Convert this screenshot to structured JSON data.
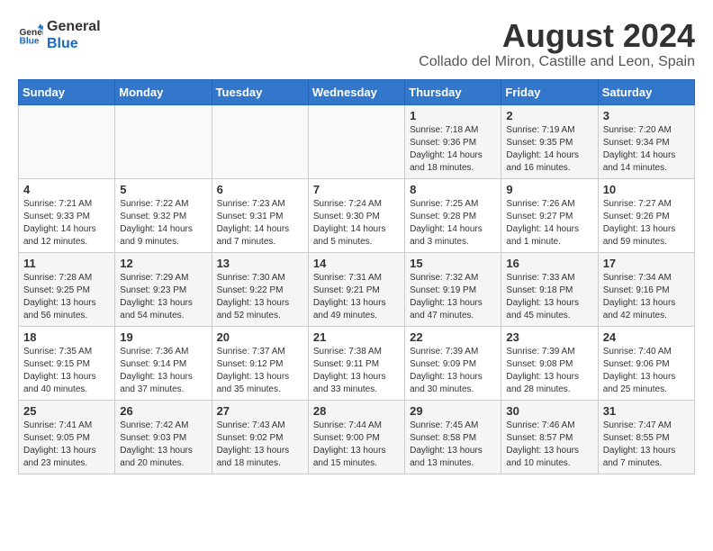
{
  "header": {
    "logo_line1": "General",
    "logo_line2": "Blue",
    "title": "August 2024",
    "subtitle": "Collado del Miron, Castille and Leon, Spain"
  },
  "columns": [
    "Sunday",
    "Monday",
    "Tuesday",
    "Wednesday",
    "Thursday",
    "Friday",
    "Saturday"
  ],
  "weeks": [
    [
      {
        "day": "",
        "info": ""
      },
      {
        "day": "",
        "info": ""
      },
      {
        "day": "",
        "info": ""
      },
      {
        "day": "",
        "info": ""
      },
      {
        "day": "1",
        "info": "Sunrise: 7:18 AM\nSunset: 9:36 PM\nDaylight: 14 hours\nand 18 minutes."
      },
      {
        "day": "2",
        "info": "Sunrise: 7:19 AM\nSunset: 9:35 PM\nDaylight: 14 hours\nand 16 minutes."
      },
      {
        "day": "3",
        "info": "Sunrise: 7:20 AM\nSunset: 9:34 PM\nDaylight: 14 hours\nand 14 minutes."
      }
    ],
    [
      {
        "day": "4",
        "info": "Sunrise: 7:21 AM\nSunset: 9:33 PM\nDaylight: 14 hours\nand 12 minutes."
      },
      {
        "day": "5",
        "info": "Sunrise: 7:22 AM\nSunset: 9:32 PM\nDaylight: 14 hours\nand 9 minutes."
      },
      {
        "day": "6",
        "info": "Sunrise: 7:23 AM\nSunset: 9:31 PM\nDaylight: 14 hours\nand 7 minutes."
      },
      {
        "day": "7",
        "info": "Sunrise: 7:24 AM\nSunset: 9:30 PM\nDaylight: 14 hours\nand 5 minutes."
      },
      {
        "day": "8",
        "info": "Sunrise: 7:25 AM\nSunset: 9:28 PM\nDaylight: 14 hours\nand 3 minutes."
      },
      {
        "day": "9",
        "info": "Sunrise: 7:26 AM\nSunset: 9:27 PM\nDaylight: 14 hours\nand 1 minute."
      },
      {
        "day": "10",
        "info": "Sunrise: 7:27 AM\nSunset: 9:26 PM\nDaylight: 13 hours\nand 59 minutes."
      }
    ],
    [
      {
        "day": "11",
        "info": "Sunrise: 7:28 AM\nSunset: 9:25 PM\nDaylight: 13 hours\nand 56 minutes."
      },
      {
        "day": "12",
        "info": "Sunrise: 7:29 AM\nSunset: 9:23 PM\nDaylight: 13 hours\nand 54 minutes."
      },
      {
        "day": "13",
        "info": "Sunrise: 7:30 AM\nSunset: 9:22 PM\nDaylight: 13 hours\nand 52 minutes."
      },
      {
        "day": "14",
        "info": "Sunrise: 7:31 AM\nSunset: 9:21 PM\nDaylight: 13 hours\nand 49 minutes."
      },
      {
        "day": "15",
        "info": "Sunrise: 7:32 AM\nSunset: 9:19 PM\nDaylight: 13 hours\nand 47 minutes."
      },
      {
        "day": "16",
        "info": "Sunrise: 7:33 AM\nSunset: 9:18 PM\nDaylight: 13 hours\nand 45 minutes."
      },
      {
        "day": "17",
        "info": "Sunrise: 7:34 AM\nSunset: 9:16 PM\nDaylight: 13 hours\nand 42 minutes."
      }
    ],
    [
      {
        "day": "18",
        "info": "Sunrise: 7:35 AM\nSunset: 9:15 PM\nDaylight: 13 hours\nand 40 minutes."
      },
      {
        "day": "19",
        "info": "Sunrise: 7:36 AM\nSunset: 9:14 PM\nDaylight: 13 hours\nand 37 minutes."
      },
      {
        "day": "20",
        "info": "Sunrise: 7:37 AM\nSunset: 9:12 PM\nDaylight: 13 hours\nand 35 minutes."
      },
      {
        "day": "21",
        "info": "Sunrise: 7:38 AM\nSunset: 9:11 PM\nDaylight: 13 hours\nand 33 minutes."
      },
      {
        "day": "22",
        "info": "Sunrise: 7:39 AM\nSunset: 9:09 PM\nDaylight: 13 hours\nand 30 minutes."
      },
      {
        "day": "23",
        "info": "Sunrise: 7:39 AM\nSunset: 9:08 PM\nDaylight: 13 hours\nand 28 minutes."
      },
      {
        "day": "24",
        "info": "Sunrise: 7:40 AM\nSunset: 9:06 PM\nDaylight: 13 hours\nand 25 minutes."
      }
    ],
    [
      {
        "day": "25",
        "info": "Sunrise: 7:41 AM\nSunset: 9:05 PM\nDaylight: 13 hours\nand 23 minutes."
      },
      {
        "day": "26",
        "info": "Sunrise: 7:42 AM\nSunset: 9:03 PM\nDaylight: 13 hours\nand 20 minutes."
      },
      {
        "day": "27",
        "info": "Sunrise: 7:43 AM\nSunset: 9:02 PM\nDaylight: 13 hours\nand 18 minutes."
      },
      {
        "day": "28",
        "info": "Sunrise: 7:44 AM\nSunset: 9:00 PM\nDaylight: 13 hours\nand 15 minutes."
      },
      {
        "day": "29",
        "info": "Sunrise: 7:45 AM\nSunset: 8:58 PM\nDaylight: 13 hours\nand 13 minutes."
      },
      {
        "day": "30",
        "info": "Sunrise: 7:46 AM\nSunset: 8:57 PM\nDaylight: 13 hours\nand 10 minutes."
      },
      {
        "day": "31",
        "info": "Sunrise: 7:47 AM\nSunset: 8:55 PM\nDaylight: 13 hours\nand 7 minutes."
      }
    ]
  ]
}
